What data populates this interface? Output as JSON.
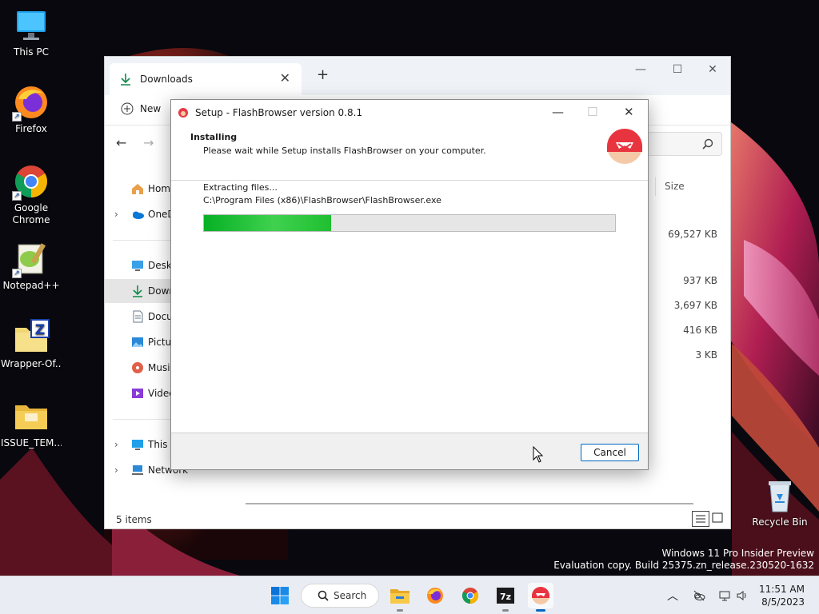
{
  "desktop": {
    "icons": [
      {
        "label": "This PC",
        "icon": "this-pc-icon"
      },
      {
        "label": "Firefox",
        "icon": "firefox-icon"
      },
      {
        "label": "Google Chrome",
        "icon": "chrome-icon"
      },
      {
        "label": "Notepad++",
        "icon": "notepadpp-icon"
      },
      {
        "label": "Wrapper-Of...",
        "icon": "zip-archive-icon"
      },
      {
        "label": "ISSUE_TEM...",
        "icon": "folder-icon"
      },
      {
        "label": "Recycle Bin",
        "icon": "recycle-bin-icon"
      }
    ],
    "watermark": {
      "line1": "Windows 11 Pro Insider Preview",
      "line2": "Evaluation copy. Build 25375.zn_release.230520-1632"
    }
  },
  "explorer": {
    "tab_title": "Downloads",
    "new_tab": "+",
    "new_button": "New",
    "sidebar": [
      {
        "label": "Home",
        "icon": "home-icon"
      },
      {
        "label": "OneDrive",
        "icon": "onedrive-icon"
      },
      {
        "label": "Desktop",
        "icon": "desktop-icon"
      },
      {
        "label": "Downloads",
        "icon": "download-icon"
      },
      {
        "label": "Documents",
        "icon": "documents-icon"
      },
      {
        "label": "Pictures",
        "icon": "pictures-icon"
      },
      {
        "label": "Music",
        "icon": "music-icon"
      },
      {
        "label": "Videos",
        "icon": "videos-icon"
      },
      {
        "label": "This PC",
        "icon": "this-pc-icon"
      },
      {
        "label": "Network",
        "icon": "network-icon"
      }
    ],
    "column_size": "Size",
    "sizes": [
      "69,527 KB",
      "937 KB",
      "3,697 KB",
      "416 KB",
      "3 KB"
    ],
    "status": "5 items"
  },
  "setup": {
    "title": "Setup - FlashBrowser version 0.8.1",
    "heading": "Installing",
    "subheading": "Please wait while Setup installs FlashBrowser on your computer.",
    "status_text": "Extracting files...",
    "current_file": "C:\\Program Files (x86)\\FlashBrowser\\FlashBrowser.exe",
    "progress": 0.31,
    "cancel_label": "Cancel"
  },
  "taskbar": {
    "search_label": "Search",
    "apps": [
      "start-icon",
      "file-explorer-icon",
      "firefox-icon",
      "chrome-icon",
      "7zip-icon",
      "flashbrowser-setup-icon"
    ],
    "time": "11:51 AM",
    "date": "8/5/2023"
  },
  "colors": {
    "progress_green": "#06b025",
    "accent": "#0067c0"
  }
}
